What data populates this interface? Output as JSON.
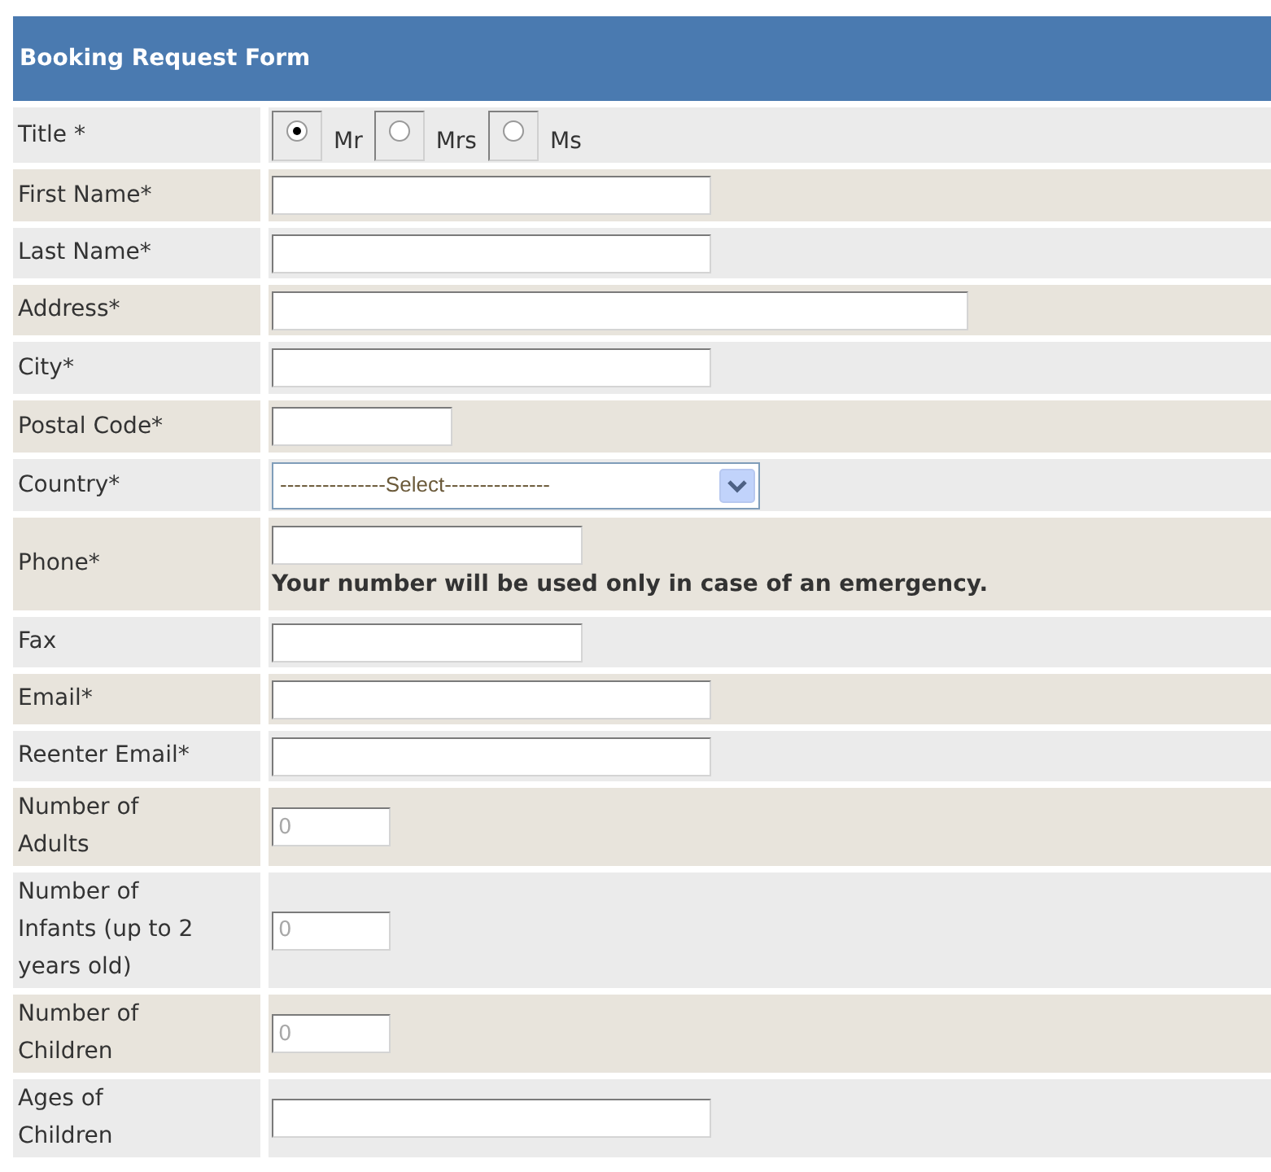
{
  "form": {
    "title": "Booking Request Form",
    "rows": [
      {
        "label": "Title *",
        "kind": "radio",
        "options": [
          {
            "label": "Mr",
            "selected": true
          },
          {
            "label": "Mrs",
            "selected": false
          },
          {
            "label": "Ms",
            "selected": false
          }
        ]
      },
      {
        "label": "First Name*",
        "kind": "text"
      },
      {
        "label": "Last Name*",
        "kind": "text"
      },
      {
        "label": "Address*",
        "kind": "address"
      },
      {
        "label": "City*",
        "kind": "text"
      },
      {
        "label": "Postal Code*",
        "kind": "postal"
      },
      {
        "label": "Country*",
        "kind": "select",
        "value": "---------------Select---------------"
      },
      {
        "label": "Phone*",
        "kind": "phone",
        "note": "Your number will be used only in case of an emergency."
      },
      {
        "label": "Fax",
        "kind": "phone"
      },
      {
        "label": "Email*",
        "kind": "text"
      },
      {
        "label": "Reenter Email*",
        "kind": "text"
      },
      {
        "label": "Number of Adults",
        "kind": "number",
        "placeholder": "0"
      },
      {
        "label": "Number of Infants (up to 2 years old)",
        "kind": "number",
        "placeholder": "0"
      },
      {
        "label": "Number of Children",
        "kind": "number",
        "placeholder": "0"
      },
      {
        "label": "Ages of Children",
        "kind": "text"
      }
    ]
  }
}
